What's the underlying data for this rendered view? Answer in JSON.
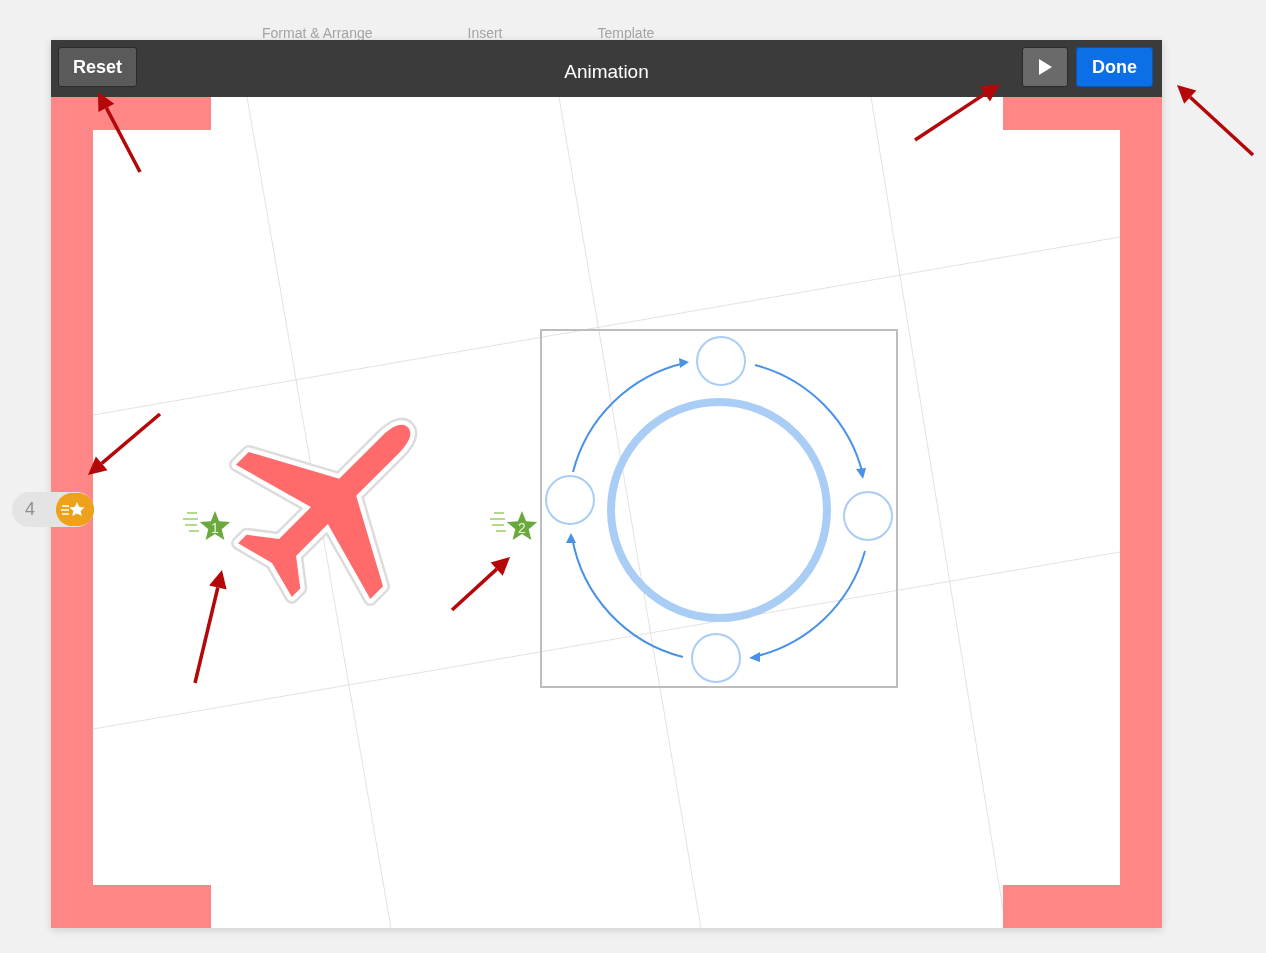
{
  "background_toolbar": {
    "items": [
      "Format & Arrange",
      "Insert",
      "Template"
    ]
  },
  "header": {
    "reset": "Reset",
    "title": "Animation",
    "done": "Done"
  },
  "side_badge": {
    "count": "4"
  },
  "canvas": {
    "animations": [
      {
        "order": "1"
      },
      {
        "order": "2"
      }
    ]
  }
}
